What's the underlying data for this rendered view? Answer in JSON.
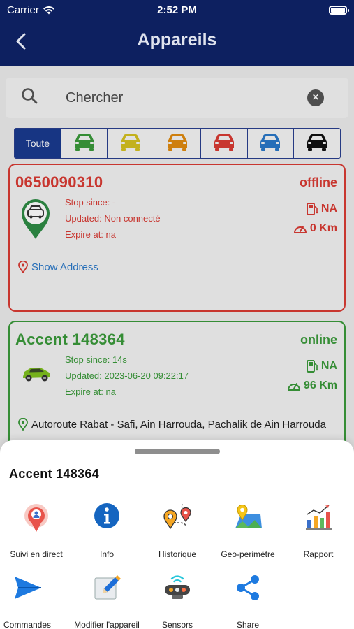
{
  "status_bar": {
    "carrier": "Carrier",
    "time": "2:52 PM"
  },
  "nav": {
    "title": "Appareils",
    "back_icon": "chevron-left-icon"
  },
  "search": {
    "placeholder": "Chercher",
    "search_icon": "search-icon",
    "clear_icon": "clear-icon"
  },
  "filters": {
    "all_label": "Toute",
    "car_colors": [
      "#3a9a3a",
      "#d4c020",
      "#e08a10",
      "#d93b34",
      "#2a78c8",
      "#111111"
    ]
  },
  "devices": [
    {
      "name": "0650090310",
      "status": "offline",
      "stop_since": "Stop since: -",
      "updated": "Updated: Non connecté",
      "expire": "Expire at: na",
      "fuel": "NA",
      "distance": "0 Km",
      "address": "Show Address",
      "color": "#d93b34"
    },
    {
      "name": "Accent 148364",
      "status": "online",
      "stop_since": "Stop since: 14s",
      "updated": "Updated: 2023-06-20 09:22:17",
      "expire": "Expire at: na",
      "fuel": "NA",
      "distance": "96 Km",
      "address": "Autoroute Rabat - Safi, Ain Harrouda, Pachalik de Ain Harrouda",
      "color": "#3a9a3a"
    }
  ],
  "sheet": {
    "title": "Accent 148364",
    "actions": [
      {
        "label": "Suivi en direct",
        "icon": "live-tracking-icon"
      },
      {
        "label": "Info",
        "icon": "info-icon"
      },
      {
        "label": "Historique",
        "icon": "history-route-icon"
      },
      {
        "label": "Geo-perimètre",
        "icon": "geofence-map-icon"
      },
      {
        "label": "Rapport",
        "icon": "report-chart-icon"
      },
      {
        "label": "Commandes spéciales",
        "icon": "send-command-icon"
      },
      {
        "label": "Modifier l'appareil",
        "icon": "edit-device-icon"
      },
      {
        "label": "Sensors",
        "icon": "sensors-icon"
      },
      {
        "label": "Share",
        "icon": "share-icon"
      }
    ]
  }
}
